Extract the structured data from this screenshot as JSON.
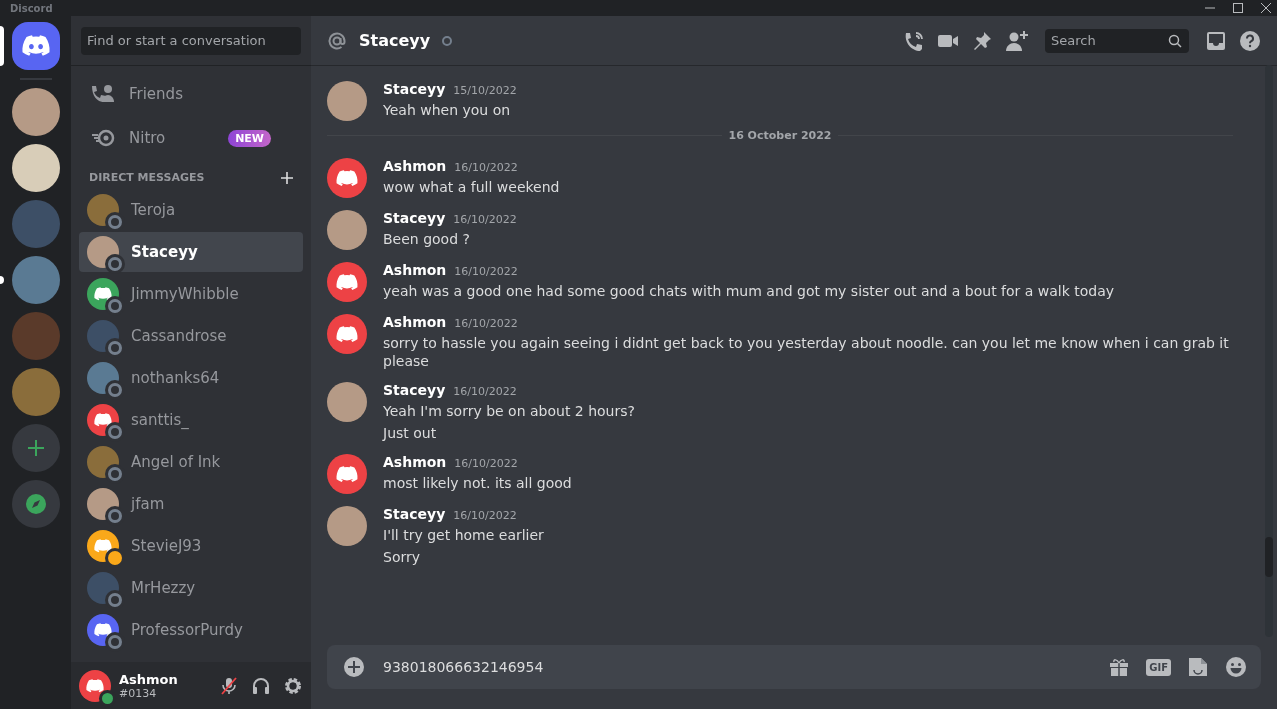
{
  "window": {
    "title": "Discord"
  },
  "servers": [
    {
      "kind": "home",
      "selected": true,
      "unread": false
    },
    {
      "kind": "server",
      "selected": false,
      "unread": false
    },
    {
      "kind": "server",
      "selected": false,
      "unread": false
    },
    {
      "kind": "server",
      "selected": false,
      "unread": false
    },
    {
      "kind": "server",
      "selected": false,
      "unread": true
    },
    {
      "kind": "server",
      "selected": false,
      "unread": false
    },
    {
      "kind": "server",
      "selected": false,
      "unread": false
    },
    {
      "kind": "add",
      "selected": false,
      "unread": false
    },
    {
      "kind": "explore",
      "selected": false,
      "unread": false
    }
  ],
  "sidebar": {
    "search": {
      "placeholder": "Find or start a conversation"
    },
    "nav": [
      {
        "kind": "friends",
        "label": "Friends"
      },
      {
        "kind": "nitro",
        "label": "Nitro",
        "badge": "NEW"
      }
    ],
    "section_title": "DIRECT MESSAGES",
    "dms": [
      {
        "name": "Teroja",
        "idle": false,
        "selected": false
      },
      {
        "name": "Staceyy",
        "idle": false,
        "selected": true
      },
      {
        "name": "JimmyWhibble",
        "color": "#3ba55c",
        "idle": false,
        "selected": false
      },
      {
        "name": "Cassandrose",
        "idle": false,
        "selected": false
      },
      {
        "name": "nothanks64",
        "idle": false,
        "selected": false
      },
      {
        "name": "santtis_",
        "color": "#ed4245",
        "idle": false,
        "selected": false
      },
      {
        "name": "Angel of Ink",
        "idle": false,
        "selected": false
      },
      {
        "name": "jfam",
        "idle": false,
        "selected": false
      },
      {
        "name": "StevieJ93",
        "color": "#faa81a",
        "idle": true,
        "selected": false
      },
      {
        "name": "MrHezzy",
        "idle": false,
        "selected": false
      },
      {
        "name": "ProfessorPurdy",
        "color": "#5865f2",
        "idle": false,
        "selected": false
      }
    ],
    "user": {
      "name": "Ashmon",
      "tag": "#0134",
      "online": true,
      "color": "#ed4245"
    }
  },
  "header": {
    "name": "Staceyy",
    "search_placeholder": "Search"
  },
  "messages": [
    {
      "kind": "message",
      "author": "Staceyy",
      "time": "15/10/2022",
      "lines": [
        "Yeah when you on"
      ]
    },
    {
      "kind": "divider",
      "label": "16 October 2022"
    },
    {
      "kind": "message",
      "author": "Ashmon",
      "color": "#ed4245",
      "time": "16/10/2022",
      "lines": [
        "wow what a full weekend"
      ]
    },
    {
      "kind": "message",
      "author": "Staceyy",
      "time": "16/10/2022",
      "lines": [
        "Been good ?"
      ]
    },
    {
      "kind": "message",
      "author": "Ashmon",
      "color": "#ed4245",
      "time": "16/10/2022",
      "lines": [
        "yeah was a good one had some good chats with mum and got my sister out and a bout for a walk today"
      ]
    },
    {
      "kind": "message",
      "author": "Ashmon",
      "color": "#ed4245",
      "time": "16/10/2022",
      "lines": [
        "sorry to hassle you again seeing i didnt get back to you yesterday about noodle. can you let me know when i can grab it please"
      ]
    },
    {
      "kind": "message",
      "author": "Staceyy",
      "time": "16/10/2022",
      "lines": [
        "Yeah I'm sorry be on about 2 hours?",
        "Just out"
      ]
    },
    {
      "kind": "message",
      "author": "Ashmon",
      "color": "#ed4245",
      "time": "16/10/2022",
      "lines": [
        "most likely not. its all good"
      ]
    },
    {
      "kind": "message",
      "author": "Staceyy",
      "time": "16/10/2022",
      "lines": [
        "I'll try get home earlier",
        "Sorry"
      ]
    }
  ],
  "composer": {
    "value": "938018066632146954",
    "gif_label": "GIF"
  }
}
